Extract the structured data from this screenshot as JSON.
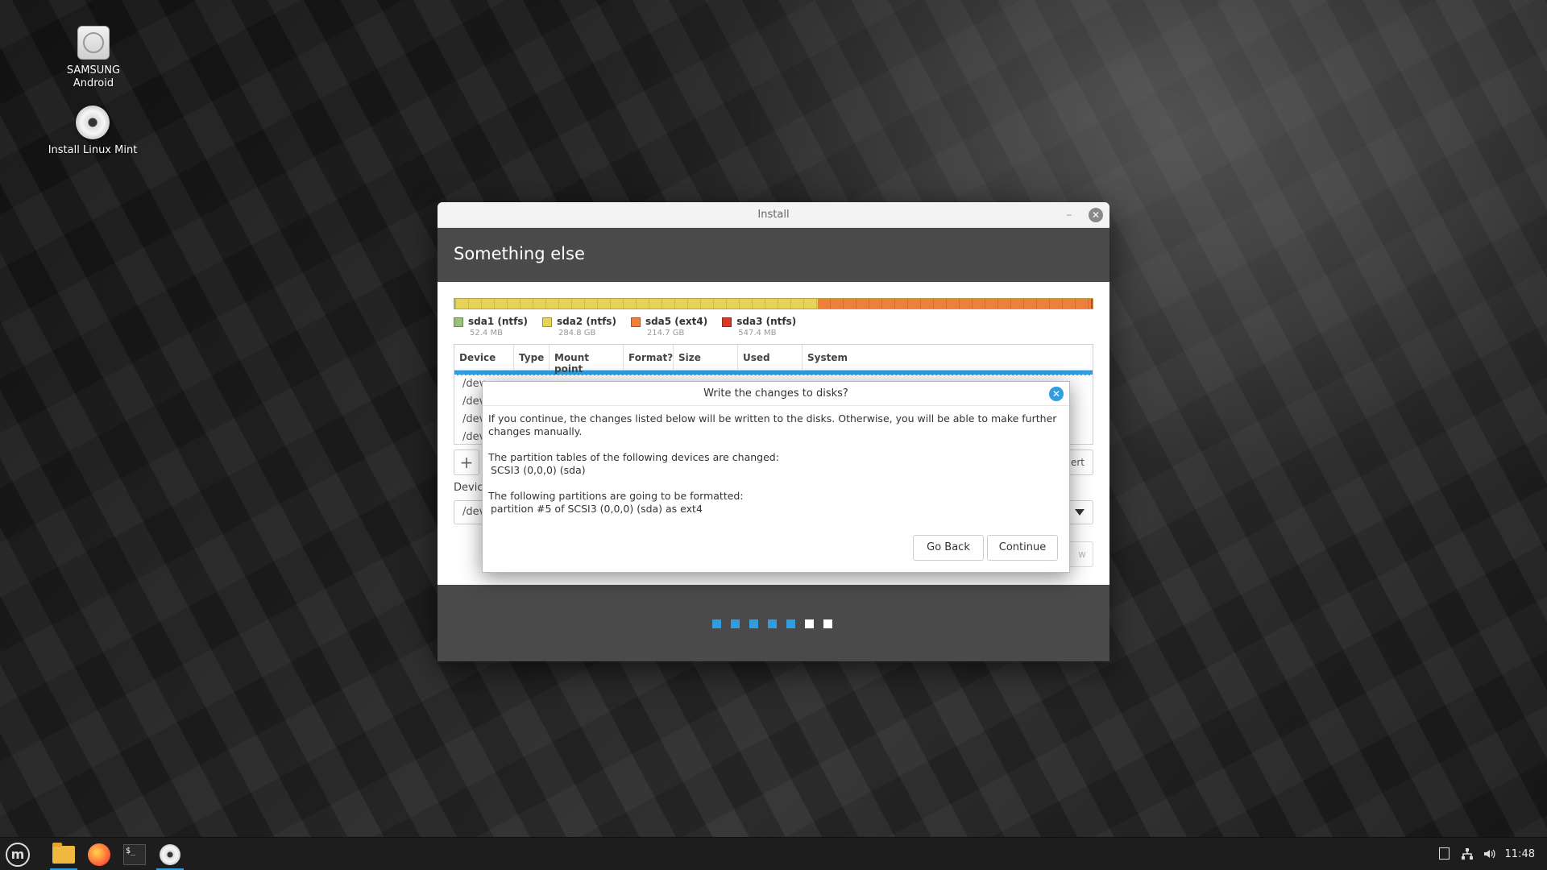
{
  "desktop": {
    "icons": [
      {
        "label_line1": "SAMSUNG",
        "label_line2": "Android",
        "icon": "usb-drive-icon"
      },
      {
        "label_line1": "Install Linux Mint",
        "icon": "disc-icon"
      }
    ]
  },
  "window": {
    "title": "Install",
    "minimize_glyph": "–",
    "close_glyph": "✕",
    "page_title": "Something else"
  },
  "partitions": {
    "colors": {
      "sda1": "#9bbf7a",
      "sda2": "#e8d35a",
      "sda5": "#ef7f3a",
      "sda3": "#d83a2a"
    },
    "legend": [
      {
        "name": "sda1 (ntfs)",
        "size": "52.4 MB",
        "color": "#9bbf7a"
      },
      {
        "name": "sda2 (ntfs)",
        "size": "284.8 GB",
        "color": "#e8d35a"
      },
      {
        "name": "sda5 (ext4)",
        "size": "214.7 GB",
        "color": "#ef7f3a"
      },
      {
        "name": "sda3 (ntfs)",
        "size": "547.4 MB",
        "color": "#d83a2a"
      }
    ],
    "bar_fractions": [
      0.0001,
      0.5697,
      0.4295,
      0.0011
    ]
  },
  "table": {
    "headers": [
      "Device",
      "Type",
      "Mount point",
      "Format?",
      "Size",
      "Used",
      "System"
    ],
    "rows": [
      "/dev",
      "/dev",
      "/dev",
      "/dev"
    ]
  },
  "controls": {
    "add_glyph": "+",
    "revert_label": "ert",
    "device_label": "Device",
    "device_value": "/dev",
    "install_now_partial": "w"
  },
  "dialog": {
    "title": "Write the changes to disks?",
    "close_glyph": "✕",
    "intro": "If you continue, the changes listed below will be written to the disks. Otherwise, you will be able to make further changes manually.",
    "tables_heading": "The partition tables of the following devices are changed:",
    "tables_device": "SCSI3 (0,0,0) (sda)",
    "format_heading": "The following partitions are going to be formatted:",
    "format_item": "partition #5 of SCSI3 (0,0,0) (sda) as ext4",
    "go_back": "Go Back",
    "continue": "Continue"
  },
  "progress": {
    "total_steps": 7,
    "completed_steps": 5,
    "accent": "#2f9de0"
  },
  "taskbar": {
    "menu_glyph": "m",
    "terminal_glyph": "$_",
    "tray": [
      "notes-icon",
      "network-icon",
      "volume-icon"
    ],
    "clock": "11:48"
  }
}
